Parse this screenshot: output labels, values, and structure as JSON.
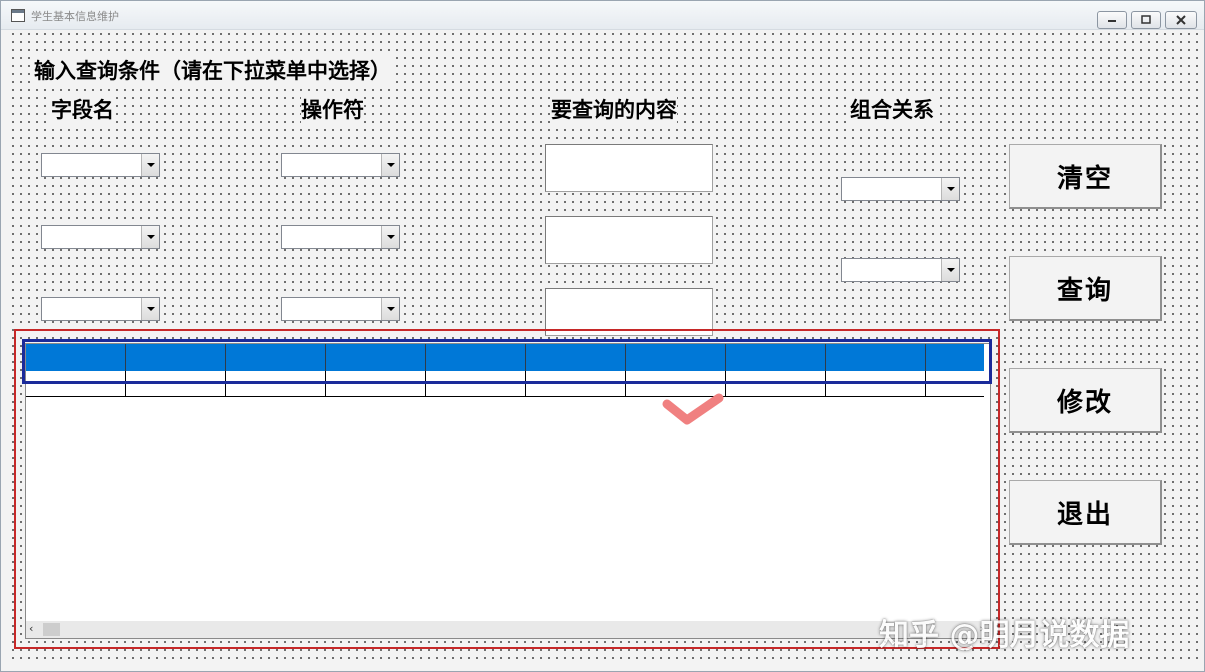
{
  "window": {
    "title": "学生基本信息维护"
  },
  "form": {
    "heading": "输入查询条件（请在下拉菜单中选择）",
    "col_field": "字段名",
    "col_operator": "操作符",
    "col_content": "要查询的内容",
    "col_relation": "组合关系"
  },
  "buttons": {
    "clear": "清空",
    "query": "查询",
    "modify": "修改",
    "exit": "退出"
  },
  "grid": {
    "columns": 10,
    "scroll_left": "‹",
    "scroll_right": "›"
  },
  "colors": {
    "header_blue": "#0078d7",
    "red_frame": "#c62828",
    "blue_frame": "#1a2a9a",
    "check": "#f08080"
  },
  "watermark": "知乎 @明月说数据"
}
